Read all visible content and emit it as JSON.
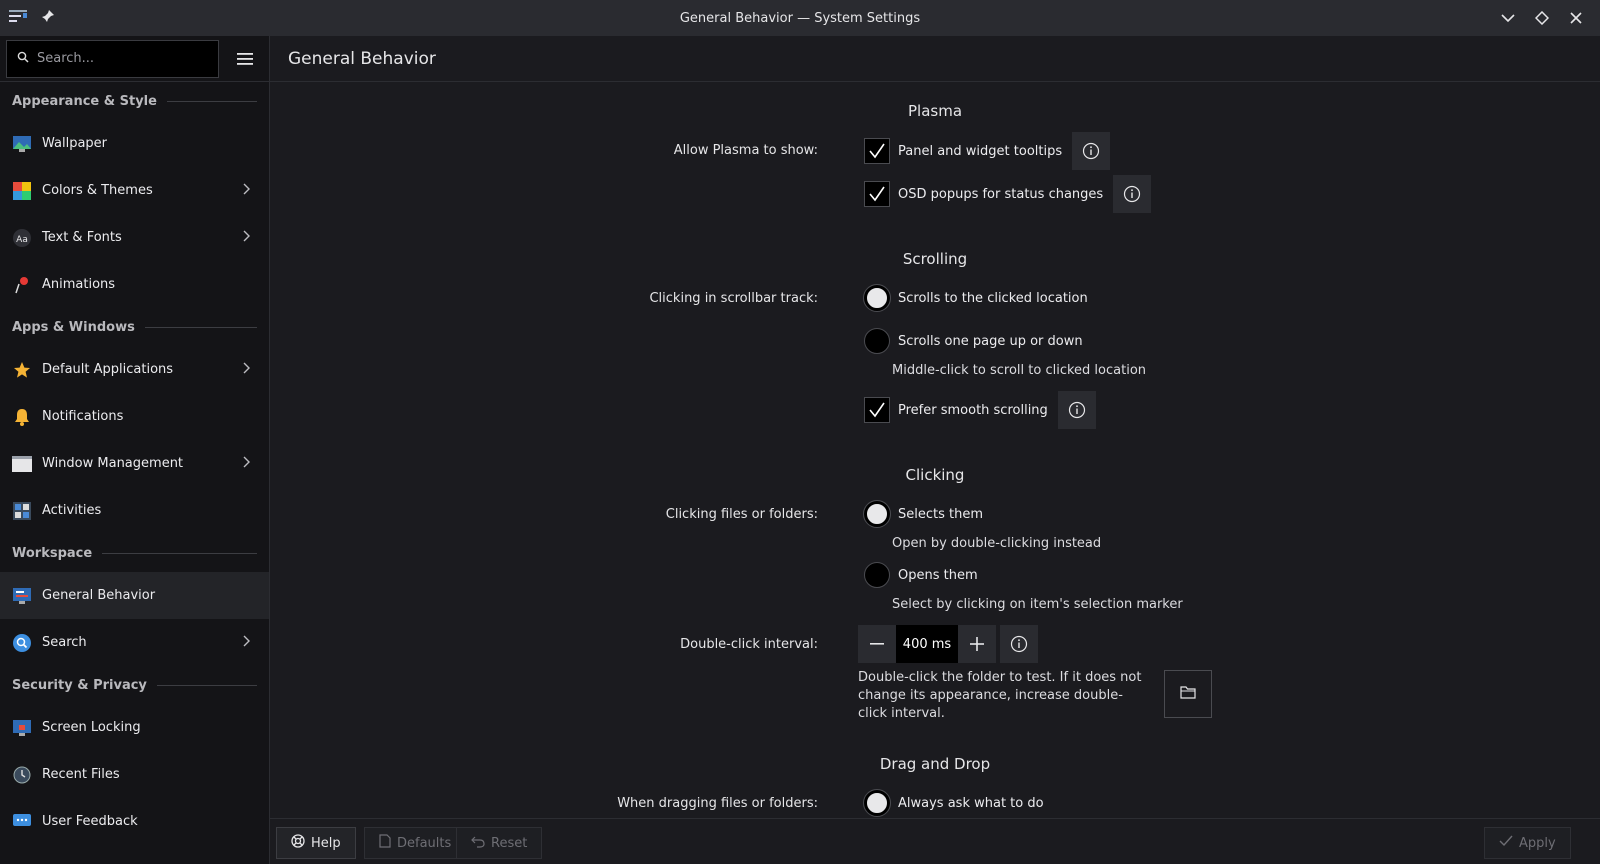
{
  "window": {
    "title": "General Behavior — System Settings"
  },
  "sidebar": {
    "search_placeholder": "Search...",
    "sections": [
      {
        "title": "Appearance & Style",
        "items": [
          {
            "label": "Wallpaper",
            "icon": "wallpaper-icon",
            "chevron": false
          },
          {
            "label": "Colors & Themes",
            "icon": "colors-icon",
            "chevron": true
          },
          {
            "label": "Text & Fonts",
            "icon": "fonts-icon",
            "chevron": true
          },
          {
            "label": "Animations",
            "icon": "animations-icon",
            "chevron": false
          }
        ]
      },
      {
        "title": "Apps & Windows",
        "items": [
          {
            "label": "Default Applications",
            "icon": "star-icon",
            "chevron": true
          },
          {
            "label": "Notifications",
            "icon": "bell-icon",
            "chevron": false
          },
          {
            "label": "Window Management",
            "icon": "window-icon",
            "chevron": true
          },
          {
            "label": "Activities",
            "icon": "activities-icon",
            "chevron": false
          }
        ]
      },
      {
        "title": "Workspace",
        "items": [
          {
            "label": "General Behavior",
            "icon": "general-behavior-icon",
            "chevron": false,
            "active": true
          },
          {
            "label": "Search",
            "icon": "search-icon",
            "chevron": true
          }
        ]
      },
      {
        "title": "Security & Privacy",
        "items": [
          {
            "label": "Screen Locking",
            "icon": "screen-lock-icon",
            "chevron": false
          },
          {
            "label": "Recent Files",
            "icon": "clock-icon",
            "chevron": false
          },
          {
            "label": "User Feedback",
            "icon": "feedback-icon",
            "chevron": false
          }
        ]
      }
    ]
  },
  "main": {
    "title": "General Behavior",
    "plasma": {
      "title": "Plasma",
      "label": "Allow Plasma to show:",
      "tooltips": "Panel and widget tooltips",
      "osd": "OSD popups for status changes"
    },
    "scrolling": {
      "title": "Scrolling",
      "label": "Clicking in scrollbar track:",
      "opt1": "Scrolls to the clicked location",
      "opt2": "Scrolls one page up or down",
      "opt2_hint": "Middle-click to scroll to clicked location",
      "smooth": "Prefer smooth scrolling"
    },
    "clicking": {
      "title": "Clicking",
      "label": "Clicking files or folders:",
      "opt1": "Selects them",
      "opt1_hint": "Open by double-clicking instead",
      "opt2": "Opens them",
      "opt2_hint": "Select by clicking on item's selection marker",
      "interval_label": "Double-click interval:",
      "interval_value": "400 ms",
      "test_hint": "Double-click the folder to test. If it does not change its appearance, increase double-click interval."
    },
    "dragdrop": {
      "title": "Drag and Drop",
      "label": "When dragging files or folders:",
      "opt1": "Always ask what to do"
    }
  },
  "footer": {
    "help": "Help",
    "defaults": "Defaults",
    "reset": "Reset",
    "apply": "Apply"
  }
}
